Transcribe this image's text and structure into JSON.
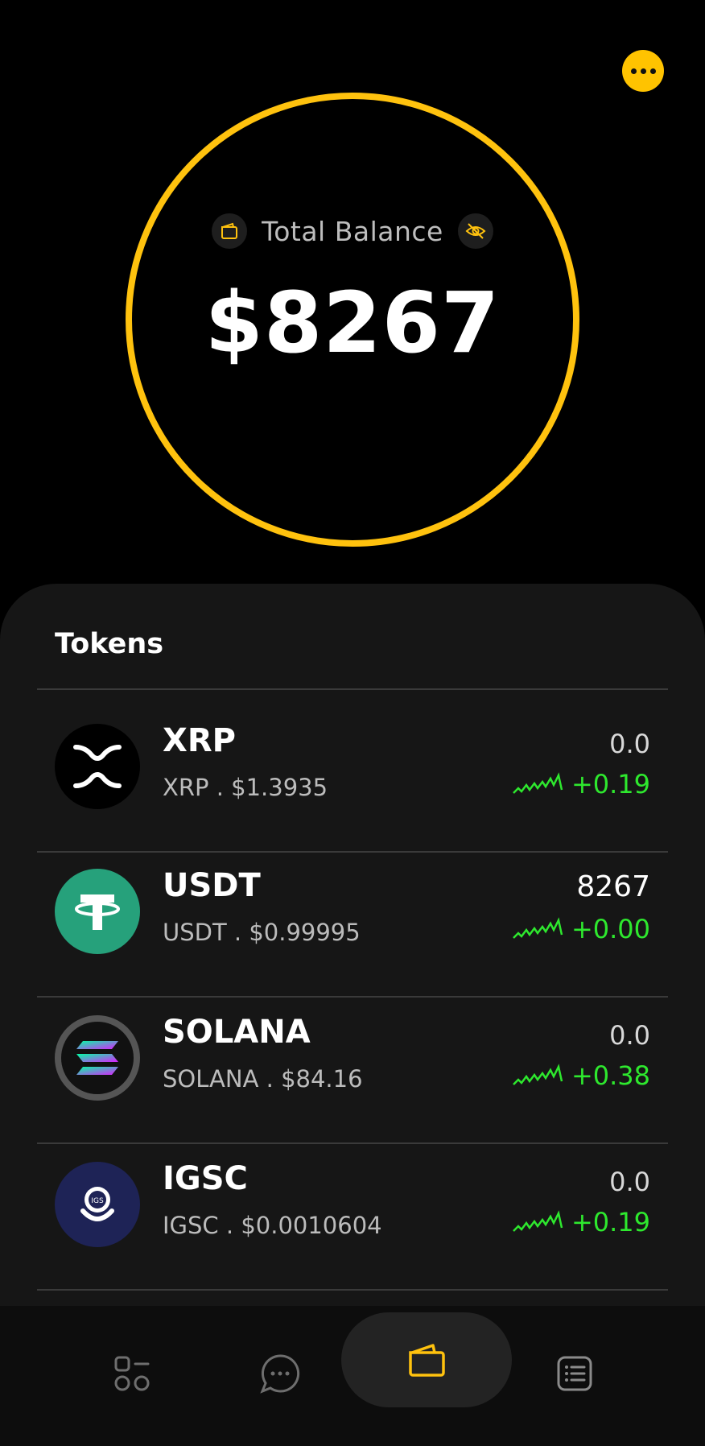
{
  "header": {
    "more_icon": "more-dots-icon"
  },
  "balance": {
    "label": "Total Balance",
    "amount": "$8267",
    "wallet_icon": "wallet-icon",
    "hide_icon": "eye-off-icon",
    "ring_color": "#FFC20E"
  },
  "tokens": {
    "title": "Tokens",
    "items": [
      {
        "name": "XRP",
        "sub": "XRP . $1.3935",
        "qty": "0.0",
        "change": "+0.19",
        "logo": "xrp-logo"
      },
      {
        "name": "USDT",
        "sub": "USDT . $0.99995",
        "qty": "8267",
        "change": "+0.00",
        "logo": "usdt-logo"
      },
      {
        "name": "SOLANA",
        "sub": "SOLANA . $84.16",
        "qty": "0.0",
        "change": "+0.38",
        "logo": "solana-logo"
      },
      {
        "name": "IGSC",
        "sub": "IGSC . $0.0010604",
        "qty": "0.0",
        "change": "+0.19",
        "logo": "igsc-logo"
      }
    ]
  },
  "nav": {
    "items": [
      {
        "icon": "dashboard-icon"
      },
      {
        "icon": "chat-icon"
      },
      {
        "icon": "wallet-icon",
        "active": true
      },
      {
        "icon": "list-icon"
      }
    ]
  },
  "colors": {
    "accent": "#FFC20E",
    "positive": "#2EE82E",
    "usdt": "#26A17B",
    "igsc": "#1E2356"
  }
}
